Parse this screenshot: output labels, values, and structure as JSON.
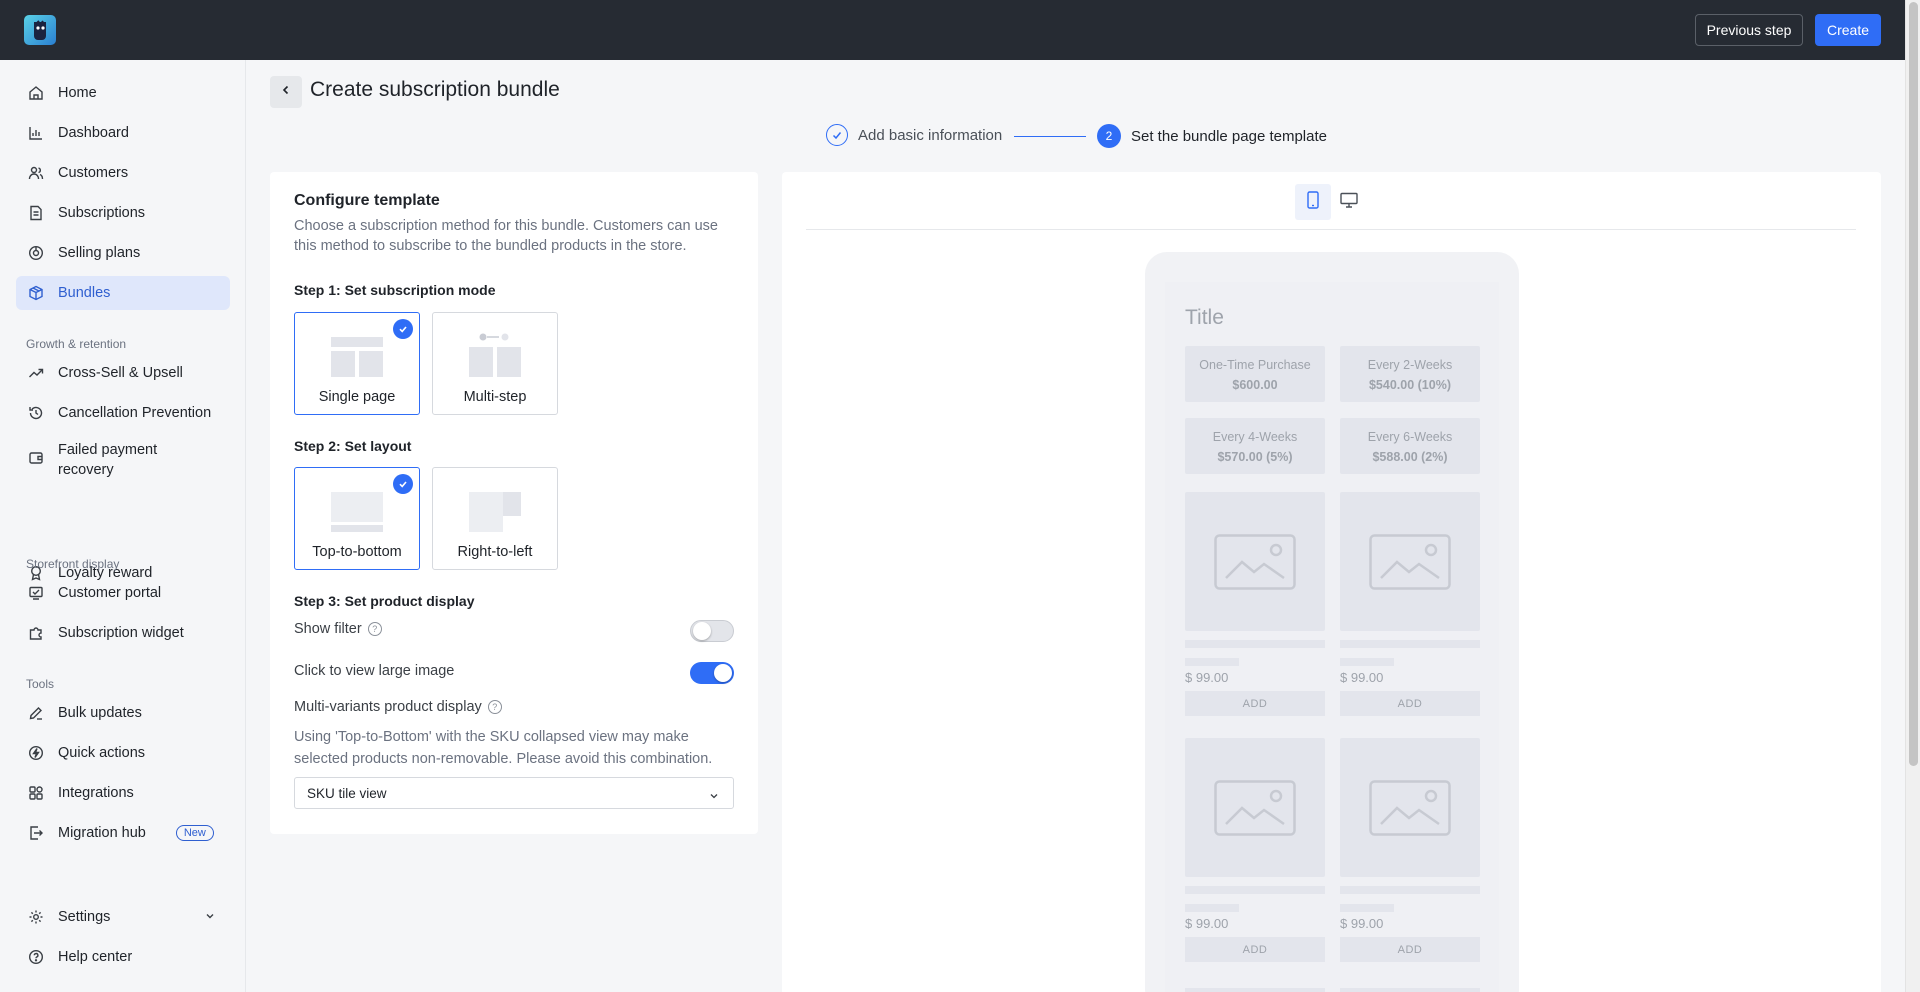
{
  "topbar": {
    "previous_step_label": "Previous step",
    "create_label": "Create"
  },
  "sidebar": {
    "items": [
      {
        "label": "Home",
        "icon": "home-icon"
      },
      {
        "label": "Dashboard",
        "icon": "bar-chart-icon"
      },
      {
        "label": "Customers",
        "icon": "users-icon"
      },
      {
        "label": "Subscriptions",
        "icon": "document-icon"
      },
      {
        "label": "Selling plans",
        "icon": "tag-icon"
      },
      {
        "label": "Bundles",
        "icon": "box-icon",
        "active": true
      }
    ],
    "groups": [
      {
        "title": "Growth & retention",
        "items": [
          {
            "label": "Cross-Sell & Upsell",
            "icon": "trend-up-icon"
          },
          {
            "label": "Cancellation Prevention",
            "icon": "history-icon"
          },
          {
            "label": "Failed payment recovery",
            "icon": "wallet-icon"
          },
          {
            "label": "Loyalty reward",
            "icon": "medal-icon"
          }
        ]
      },
      {
        "title": "Storefront display",
        "items": [
          {
            "label": "Customer portal",
            "icon": "portal-icon"
          },
          {
            "label": "Subscription widget",
            "icon": "puzzle-icon"
          }
        ]
      },
      {
        "title": "Tools",
        "items": [
          {
            "label": "Bulk updates",
            "icon": "edit-icon"
          },
          {
            "label": "Quick actions",
            "icon": "bolt-icon"
          },
          {
            "label": "Integrations",
            "icon": "grid-icon"
          },
          {
            "label": "Migration hub",
            "icon": "migration-icon",
            "badge": "New"
          }
        ]
      }
    ],
    "settings_label": "Settings",
    "help_label": "Help center"
  },
  "header": {
    "title": "Create subscription bundle"
  },
  "steps": [
    {
      "label": "Add basic information",
      "status": "done"
    },
    {
      "number": "2",
      "label": "Set the bundle page template",
      "status": "active"
    }
  ],
  "config": {
    "title": "Configure template",
    "description": "Choose a subscription method for this bundle. Customers can use this method to subscribe to the bundled products in the store.",
    "step1": {
      "heading": "Step 1: Set subscription mode",
      "options": [
        {
          "label": "Single page",
          "selected": true
        },
        {
          "label": "Multi-step",
          "selected": false
        }
      ]
    },
    "step2": {
      "heading": "Step 2: Set layout",
      "options": [
        {
          "label": "Top-to-bottom",
          "selected": true
        },
        {
          "label": "Right-to-left",
          "selected": false
        }
      ]
    },
    "step3": {
      "heading": "Step 3: Set product display",
      "show_filter_label": "Show filter",
      "show_filter_on": false,
      "large_image_label": "Click to view large image",
      "large_image_on": true,
      "multi_variants_label": "Multi-variants product display",
      "note": "Using 'Top-to-Bottom' with the SKU collapsed view may make selected products non-removable. Please avoid this combination.",
      "select_value": "SKU tile view"
    }
  },
  "preview": {
    "devices": [
      {
        "icon": "mobile-icon",
        "active": true
      },
      {
        "icon": "desktop-icon",
        "active": false
      }
    ],
    "title": "Title",
    "plans": [
      {
        "name": "One-Time Purchase",
        "price": "$600.00"
      },
      {
        "name": "Every 2-Weeks",
        "price": "$540.00 (10%)"
      },
      {
        "name": "Every 4-Weeks",
        "price": "$570.00 (5%)"
      },
      {
        "name": "Every 6-Weeks",
        "price": "$588.00 (2%)"
      }
    ],
    "products": [
      {
        "price": "$ 99.00",
        "button": "ADD"
      },
      {
        "price": "$ 99.00",
        "button": "ADD"
      },
      {
        "price": "$ 99.00",
        "button": "ADD"
      },
      {
        "price": "$ 99.00",
        "button": "ADD"
      }
    ]
  },
  "colors": {
    "topbar": "#262b33",
    "accent": "#2f6df6",
    "active_nav_bg": "#dfe7fb"
  }
}
